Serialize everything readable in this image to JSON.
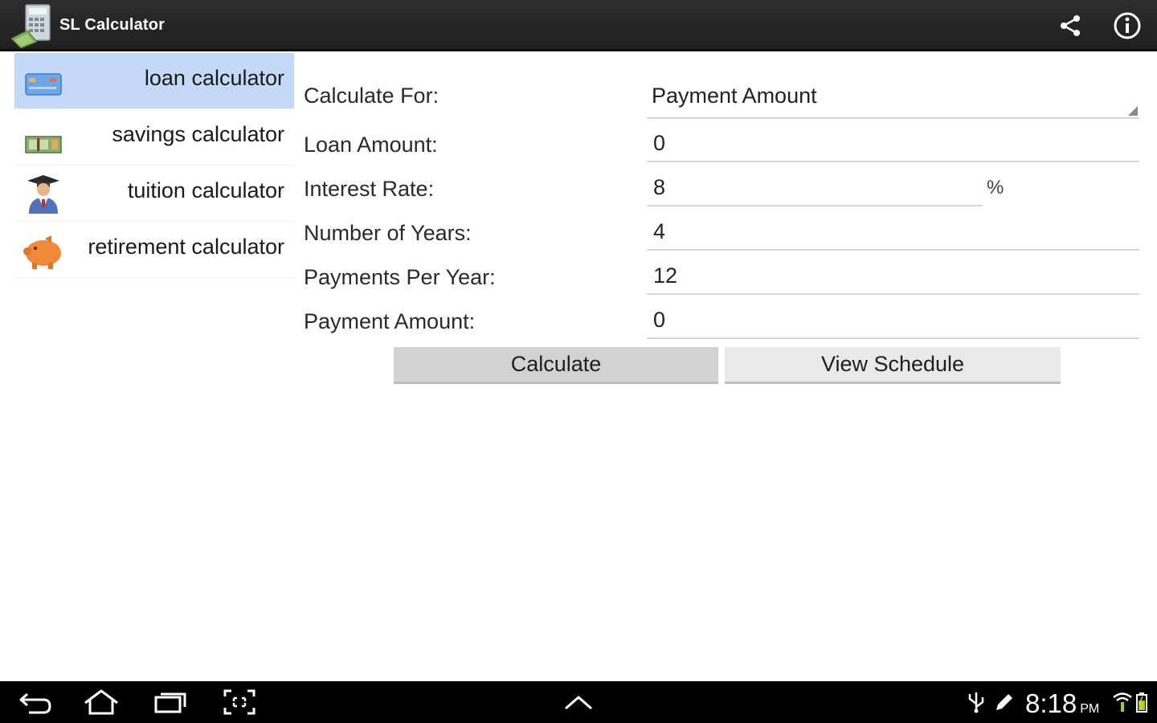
{
  "app": {
    "title": "SL Calculator",
    "icons": {
      "app": "calculator-money-icon",
      "share": "share-icon",
      "info": "info-icon"
    }
  },
  "sidebar": {
    "items": [
      {
        "label": "loan calculator",
        "icon": "credit-card-icon",
        "selected": true
      },
      {
        "label": "savings calculator",
        "icon": "money-bills-icon",
        "selected": false
      },
      {
        "label": "tuition calculator",
        "icon": "graduate-icon",
        "selected": false
      },
      {
        "label": "retirement calculator",
        "icon": "piggy-bank-icon",
        "selected": false
      }
    ]
  },
  "form": {
    "calculate_for": {
      "label": "Calculate For:",
      "value": "Payment Amount"
    },
    "loan_amount": {
      "label": "Loan Amount:",
      "value": "0"
    },
    "interest_rate": {
      "label": "Interest Rate:",
      "value": "8",
      "unit": "%"
    },
    "years": {
      "label": "Number of Years:",
      "value": "4"
    },
    "payments_per_year": {
      "label": "Payments Per Year:",
      "value": "12"
    },
    "payment_amount": {
      "label": "Payment Amount:",
      "value": "0"
    },
    "calculate_button": "Calculate",
    "schedule_button": "View Schedule"
  },
  "system_bar": {
    "time": "8:18",
    "ampm": "PM",
    "icons": [
      "back-icon",
      "home-icon",
      "recent-apps-icon",
      "screenshot-icon",
      "up-chevron-icon",
      "usb-icon",
      "pencil-icon",
      "wifi-icon",
      "battery-icon"
    ]
  },
  "colors": {
    "selected_bg": "#c4d9f7",
    "action_bar": "#2a2a2a",
    "system_bar": "#000000",
    "button_bg": "#d2d2d2"
  }
}
